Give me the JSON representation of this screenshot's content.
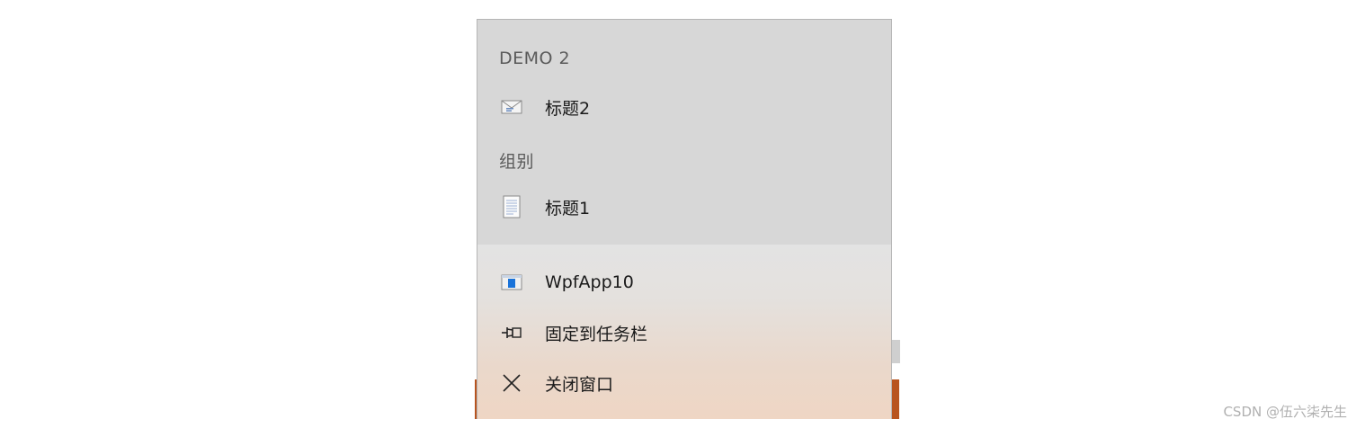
{
  "jumplist": {
    "groups": [
      {
        "header": "DEMO 2",
        "items": [
          {
            "label": "标题2",
            "icon": "envelope-icon"
          }
        ]
      },
      {
        "header": "组别",
        "items": [
          {
            "label": "标题1",
            "icon": "document-icon"
          }
        ]
      }
    ],
    "tasks": [
      {
        "label": "WpfApp10",
        "icon": "app-window-icon"
      },
      {
        "label": "固定到任务栏",
        "icon": "pin-icon"
      },
      {
        "label": "关闭窗口",
        "icon": "close-icon"
      }
    ]
  },
  "colors": {
    "menu_top": "#d7d7d7",
    "menu_bottom_tint": "#efd6c4",
    "taskbar": "#b8541f",
    "app_icon_accent": "#1a73d9"
  },
  "watermark": "CSDN @伍六柒先生"
}
